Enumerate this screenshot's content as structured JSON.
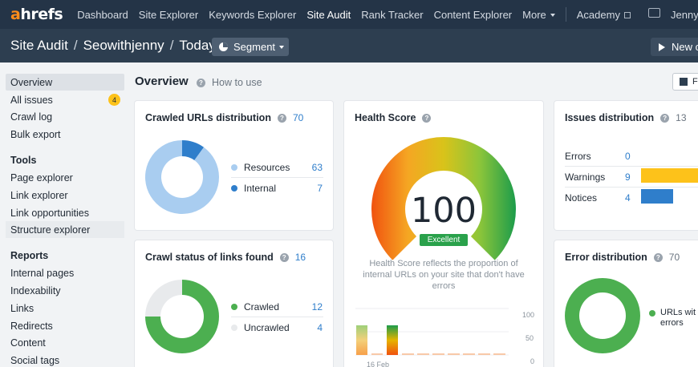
{
  "topnav": {
    "logo_a": "a",
    "logo_rest": "hrefs",
    "items": [
      "Dashboard",
      "Site Explorer",
      "Keywords Explorer",
      "Site Audit",
      "Rank Tracker",
      "Content Explorer",
      "More"
    ],
    "academy": "Academy",
    "user": "Jenny",
    "icons": [
      "external-link-icon",
      "screen-icon"
    ]
  },
  "breadcrumb": {
    "section": "Site Audit",
    "project": "Seowithjenny",
    "date": "Today"
  },
  "segment_label": "Segment",
  "new_label": "New c",
  "sidebar": {
    "items_top": [
      "Overview",
      "All issues",
      "Crawl log",
      "Bulk export"
    ],
    "all_issues_badge": "4",
    "tools_heading": "Tools",
    "tools": [
      "Page explorer",
      "Link explorer",
      "Link opportunities",
      "Structure explorer"
    ],
    "reports_heading": "Reports",
    "reports": [
      "Internal pages",
      "Indexability",
      "Links",
      "Redirects",
      "Content",
      "Social tags"
    ]
  },
  "overview": {
    "title": "Overview",
    "how_to": "How to use",
    "export_label": "F"
  },
  "crawled": {
    "title": "Crawled URLs distribution",
    "total": "70",
    "legend": [
      {
        "label": "Resources",
        "value": "63",
        "color": "#a9cdf0"
      },
      {
        "label": "Internal",
        "value": "7",
        "color": "#2f7ecb"
      }
    ]
  },
  "crawl_status": {
    "title": "Crawl status of links found",
    "total": "16",
    "legend": [
      {
        "label": "Crawled",
        "value": "12",
        "color": "#4caf50"
      },
      {
        "label": "Uncrawled",
        "value": "4",
        "color": "#e8eaec"
      }
    ]
  },
  "health": {
    "title": "Health Score",
    "score": "100",
    "badge": "Excellent",
    "description": "Health Score reflects the proportion of internal URLs on your site that don't have errors",
    "y_ticks": [
      "100",
      "50",
      "0"
    ],
    "x_label": "16 Feb"
  },
  "issues": {
    "title": "Issues distribution",
    "total": "13",
    "rows": [
      {
        "label": "Errors",
        "value": "0",
        "color": "#e53935"
      },
      {
        "label": "Warnings",
        "value": "9",
        "color": "#fdc21a"
      },
      {
        "label": "Notices",
        "value": "4",
        "color": "#2f7ecb"
      }
    ]
  },
  "errors": {
    "title": "Error distribution",
    "total": "70",
    "legend_line1": "URLs wit",
    "legend_line2": "errors",
    "legend_color": "#4caf50"
  },
  "chart_data": [
    {
      "type": "pie",
      "title": "Crawled URLs distribution",
      "categories": [
        "Resources",
        "Internal"
      ],
      "values": [
        63,
        7
      ]
    },
    {
      "type": "pie",
      "title": "Crawl status of links found",
      "categories": [
        "Crawled",
        "Uncrawled"
      ],
      "values": [
        12,
        4
      ]
    },
    {
      "type": "bar",
      "title": "Issues distribution",
      "categories": [
        "Errors",
        "Warnings",
        "Notices"
      ],
      "values": [
        0,
        9,
        4
      ]
    },
    {
      "type": "pie",
      "title": "Error distribution",
      "categories": [
        "URLs with errors"
      ],
      "values": [
        70
      ]
    }
  ]
}
